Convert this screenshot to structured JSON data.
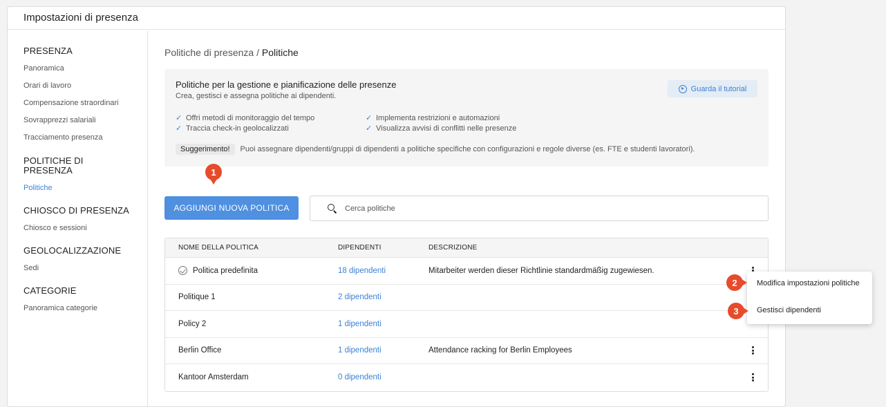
{
  "window": {
    "title": "Impostazioni di presenza"
  },
  "sidebar": {
    "sections": [
      {
        "heading": "PRESENZA",
        "items": [
          "Panoramica",
          "Orari di lavoro",
          "Compensazione straordinari",
          "Sovrapprezzi salariali",
          "Tracciamento presenza"
        ]
      },
      {
        "heading": "POLITICHE DI PRESENZA",
        "items": [
          "Politiche"
        ]
      },
      {
        "heading": "CHIOSCO DI PRESENZA",
        "items": [
          "Chiosco e sessioni"
        ]
      },
      {
        "heading": "GEOLOCALIZZAZIONE",
        "items": [
          "Sedi"
        ]
      },
      {
        "heading": "CATEGORIE",
        "items": [
          "Panoramica categorie"
        ]
      }
    ],
    "active_item": "Politiche"
  },
  "breadcrumb": {
    "parent": "Politiche di presenza",
    "separator": " / ",
    "current": "Politiche"
  },
  "info": {
    "title": "Politiche per la gestione e pianificazione delle presenze",
    "subtitle": "Crea, gestisci e assegna politiche ai dipendenti.",
    "tutorial_label": "Guarda il tutorial",
    "features_left": [
      "Offri metodi di monitoraggio del tempo",
      "Traccia check-in geolocalizzati"
    ],
    "features_right": [
      "Implementa restrizioni e automazioni",
      "Visualizza avvisi di conflitti nelle presenze"
    ],
    "tip_label": "Suggerimento!",
    "tip_text": "Puoi assegnare dipendenti/gruppi di dipendenti a politiche specifiche con configurazioni e regole diverse (es. FTE e studenti lavoratori)."
  },
  "actions": {
    "add_label": "AGGIUNGI NUOVA POLITICA"
  },
  "search": {
    "placeholder": "Cerca politiche",
    "value": ""
  },
  "table": {
    "headers": [
      "NOME DELLA POLITICA",
      "DIPENDENTI",
      "DESCRIZIONE"
    ],
    "rows": [
      {
        "name": "Politica predefinita",
        "employees": "18 dipendenti",
        "description": "Mitarbeiter werden dieser Richtlinie standardmäßig zugewiesen.",
        "default": true
      },
      {
        "name": "Politique 1",
        "employees": "2 dipendenti",
        "description": ""
      },
      {
        "name": "Policy 2",
        "employees": "1 dipendenti",
        "description": ""
      },
      {
        "name": "Berlin Office",
        "employees": "1 dipendenti",
        "description": "Attendance racking for Berlin Employees"
      },
      {
        "name": "Kantoor Amsterdam",
        "employees": "0 dipendenti",
        "description": ""
      }
    ]
  },
  "context_menu": {
    "items": [
      "Modifica impostazioni politiche",
      "Gestisci dipendenti"
    ]
  },
  "markers": [
    "1",
    "2",
    "3"
  ],
  "colors": {
    "accent": "#4f90e0",
    "link": "#3b82d6",
    "marker": "#e74b2c"
  }
}
